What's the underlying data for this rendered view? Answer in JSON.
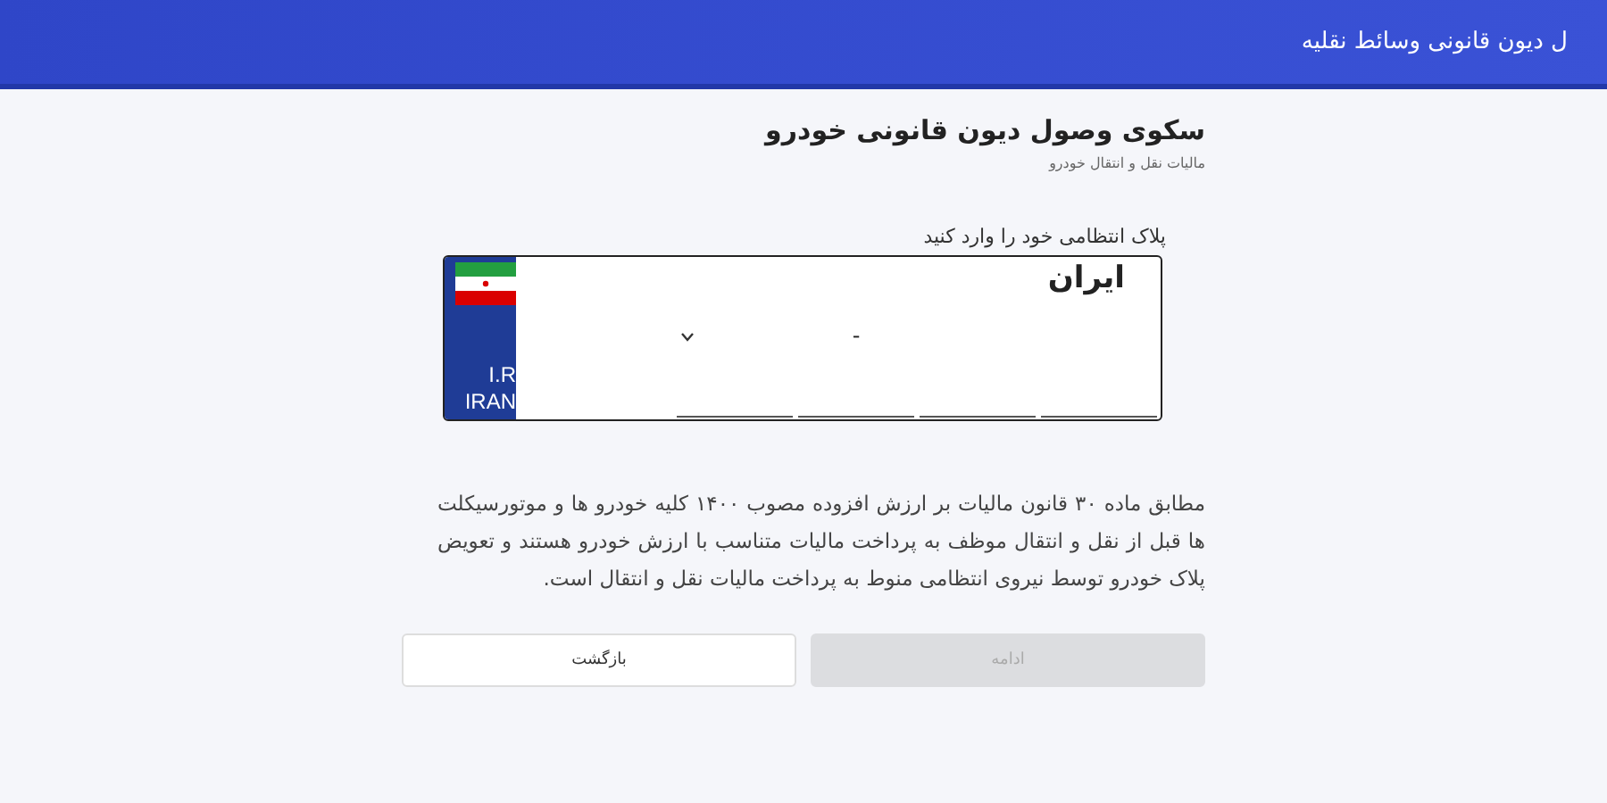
{
  "header": {
    "title": "ل دیون قانونی وسائط نقلیه"
  },
  "page": {
    "title": "سکوی وصول دیون قانونی خودرو",
    "subtitle": "مالیات نقل و انتقال خودرو"
  },
  "plate_form": {
    "label": "پلاک انتظامی خود را وارد کنید",
    "country_word": "ایران",
    "strip_lines": [
      "I.R",
      "IRAN"
    ],
    "fields": [
      {
        "kind": "digits"
      },
      {
        "kind": "digits"
      },
      {
        "kind": "letter",
        "value": "-"
      },
      {
        "kind": "digits"
      }
    ]
  },
  "notice": "مطابق ماده ۳۰ قانون مالیات بر ارزش افزوده مصوب ۱۴۰۰ کلیه خودرو ها و موتورسیکلت ها قبل از نقل و انتقال موظف به پرداخت مالیات متناسب با ارزش خودرو هستند و تعویض پلاک خودرو توسط نیروی انتظامی منوط به پرداخت مالیات نقل و انتقال است.",
  "buttons": [
    {
      "label": "ادامه",
      "disabled": true
    },
    {
      "label": "بازگشت",
      "disabled": false
    }
  ]
}
